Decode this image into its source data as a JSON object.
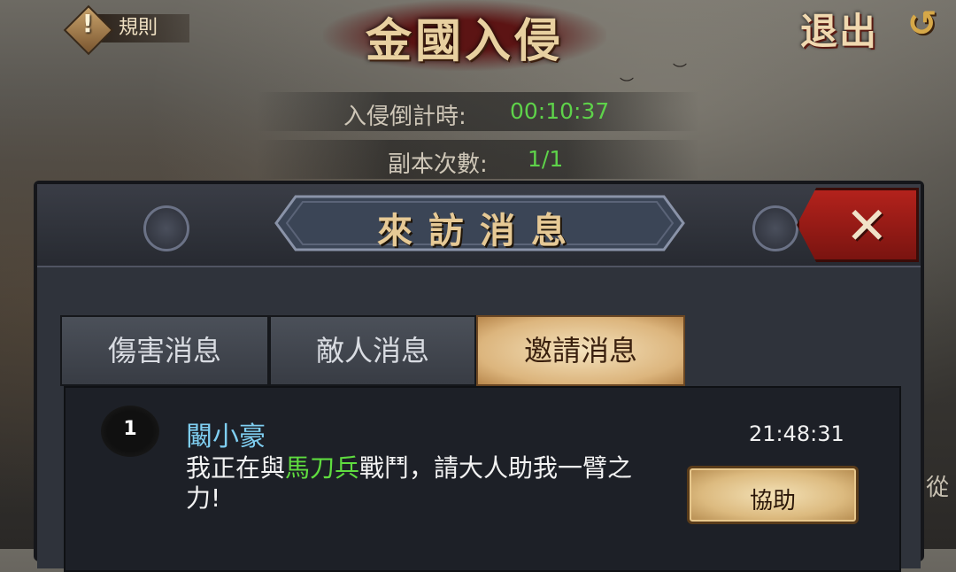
{
  "top_bar": {
    "rules_label": "規則",
    "rules_icon": "exclamation-icon",
    "title": "金國入侵",
    "exit_label": "退出",
    "exit_icon": "return-arrow-icon"
  },
  "status": {
    "countdown_label": "入侵倒計時:",
    "countdown_value": "00:10:37",
    "attempts_label": "副本次數:",
    "attempts_value": "1/1"
  },
  "dialog": {
    "title": "來訪消息",
    "close_icon": "close-x-icon",
    "tabs": [
      {
        "label": "傷害消息",
        "active": false
      },
      {
        "label": "敵人消息",
        "active": false
      },
      {
        "label": "邀請消息",
        "active": true
      }
    ],
    "messages": [
      {
        "rank": "1",
        "sender": "闞小豪",
        "time": "21:48:31",
        "text_before": "我正在與",
        "unit": "馬刀兵",
        "text_after": "戰鬥，請大人助我一臂之力!",
        "action_label": "協助"
      }
    ]
  },
  "background": {
    "side_text": "兵(從"
  },
  "colors": {
    "countdown_green": "#5ed24a",
    "sender_blue": "#7fcff2",
    "unit_green": "#5fdc3f",
    "close_red": "#b3221c"
  }
}
